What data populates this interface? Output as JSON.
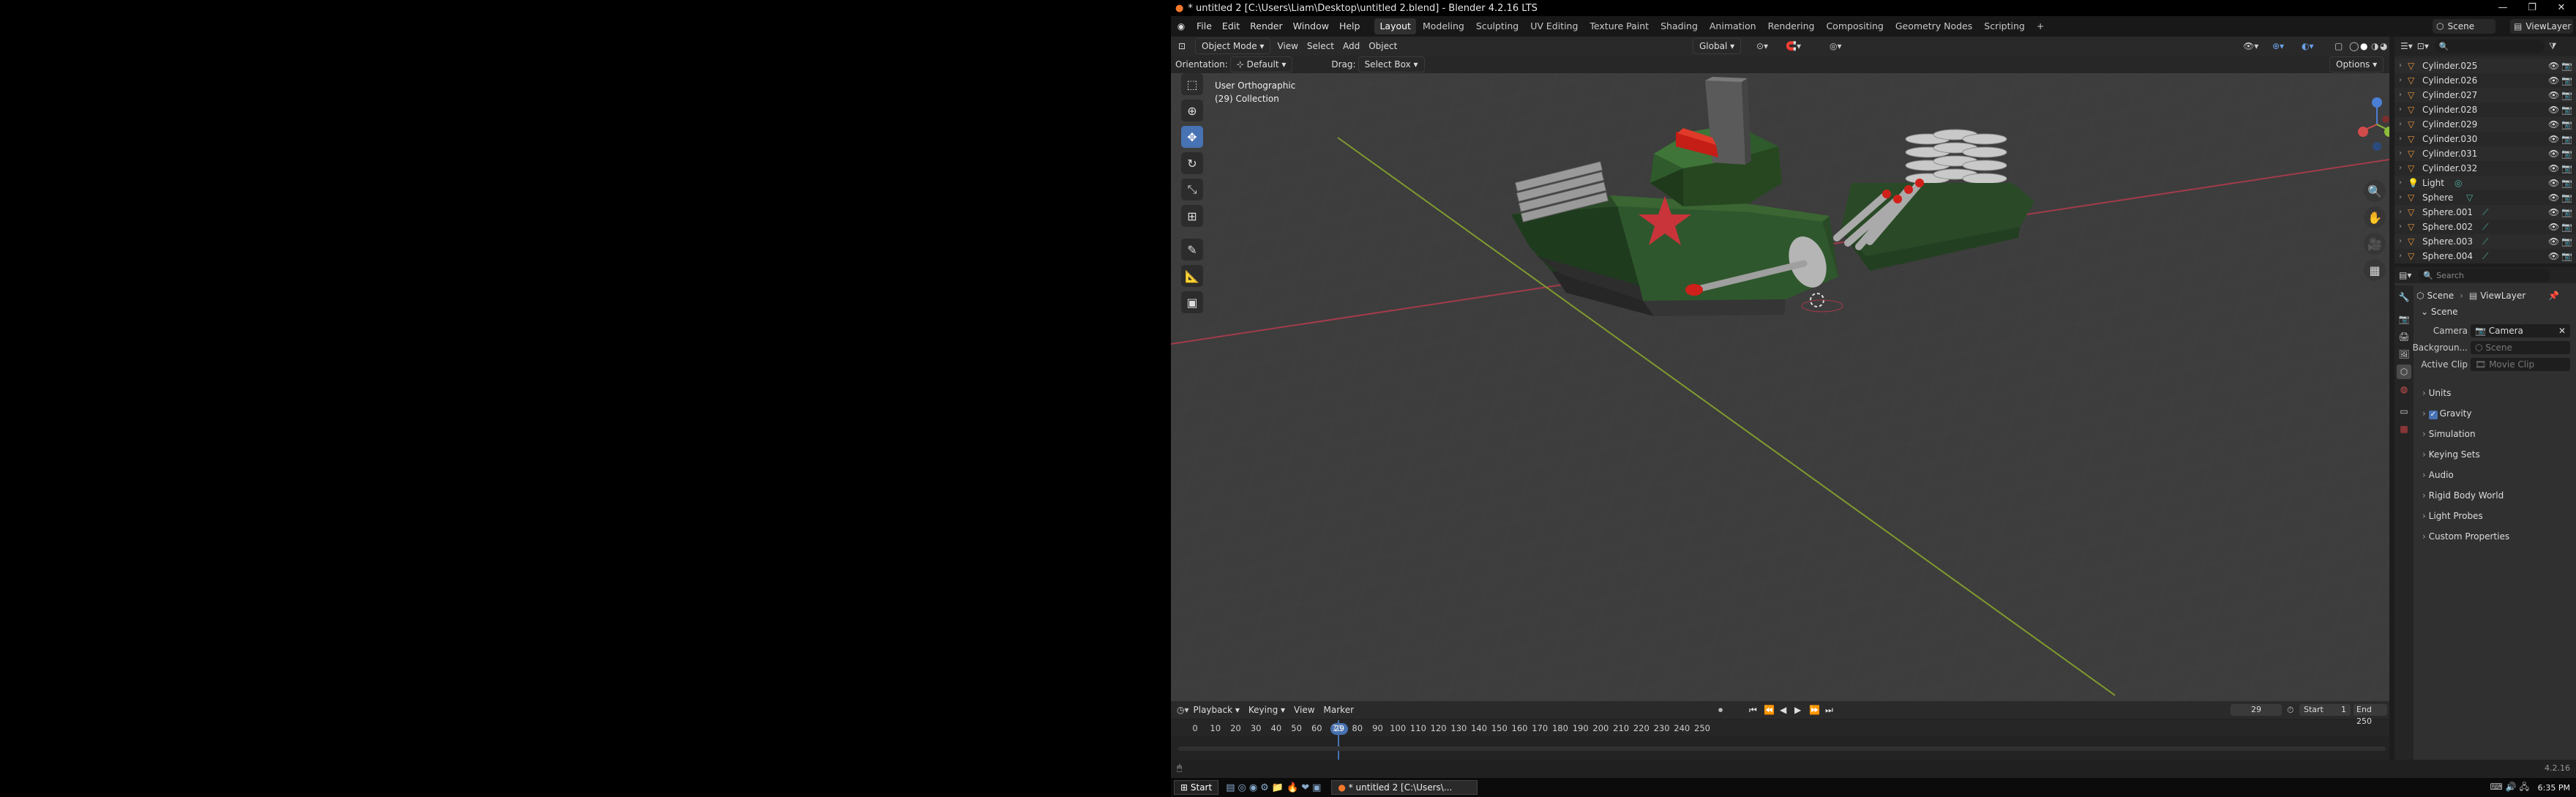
{
  "title": "* untitled 2 [C:\\Users\\Liam\\Desktop\\untitled 2.blend] - Blender 4.2.16 LTS",
  "menus": [
    "File",
    "Edit",
    "Render",
    "Window",
    "Help"
  ],
  "workspaces": [
    "Layout",
    "Modeling",
    "Sculpting",
    "UV Editing",
    "Texture Paint",
    "Shading",
    "Animation",
    "Rendering",
    "Compositing",
    "Geometry Nodes",
    "Scripting"
  ],
  "active_workspace": "Layout",
  "scene_field": "Scene",
  "viewlayer_field": "ViewLayer",
  "viewport": {
    "mode": "Object Mode",
    "menus": [
      "View",
      "Select",
      "Add",
      "Object"
    ],
    "transform_orientation": "Global",
    "orientation_label": "Orientation:",
    "orientation_value": "Default",
    "drag_label": "Drag:",
    "drag_value": "Select Box",
    "options": "Options",
    "view_name": "User Orthographic",
    "collection_info": "(29) Collection"
  },
  "outliner": {
    "search_placeholder": "",
    "items": [
      "Cylinder.025",
      "Cylinder.026",
      "Cylinder.027",
      "Cylinder.028",
      "Cylinder.029",
      "Cylinder.030",
      "Cylinder.031",
      "Cylinder.032",
      "Light",
      "Sphere",
      "Sphere.001",
      "Sphere.002",
      "Sphere.003",
      "Sphere.004"
    ]
  },
  "properties": {
    "search_placeholder": "Search",
    "breadcrumb_scene": "Scene",
    "breadcrumb_viewlayer": "ViewLayer",
    "section_scene": "Scene",
    "camera_label": "Camera",
    "camera_value": "Camera",
    "background_label": "Backgroun...",
    "background_placeholder": "Scene",
    "active_clip_label": "Active Clip",
    "active_clip_placeholder": "Movie Clip",
    "sections": [
      "Units",
      "Gravity",
      "Simulation",
      "Keying Sets",
      "Audio",
      "Rigid Body World",
      "Light Probes",
      "Custom Properties"
    ]
  },
  "timeline": {
    "menus": [
      "Playback",
      "Keying",
      "View",
      "Marker"
    ],
    "current_frame": "29",
    "start_label": "Start",
    "start_value": "1",
    "end_label": "End",
    "end_value": "250",
    "ticks": [
      "0",
      "10",
      "20",
      "30",
      "40",
      "50",
      "60",
      "70",
      "80",
      "90",
      "100",
      "110",
      "120",
      "130",
      "140",
      "150",
      "160",
      "170",
      "180",
      "190",
      "200",
      "210",
      "220",
      "230",
      "240",
      "250"
    ]
  },
  "status": {
    "version": "4.2.16"
  },
  "taskbar": {
    "start": "Start",
    "task": "* untitled 2 [C:\\Users\\...",
    "clock": "6:35 PM"
  }
}
